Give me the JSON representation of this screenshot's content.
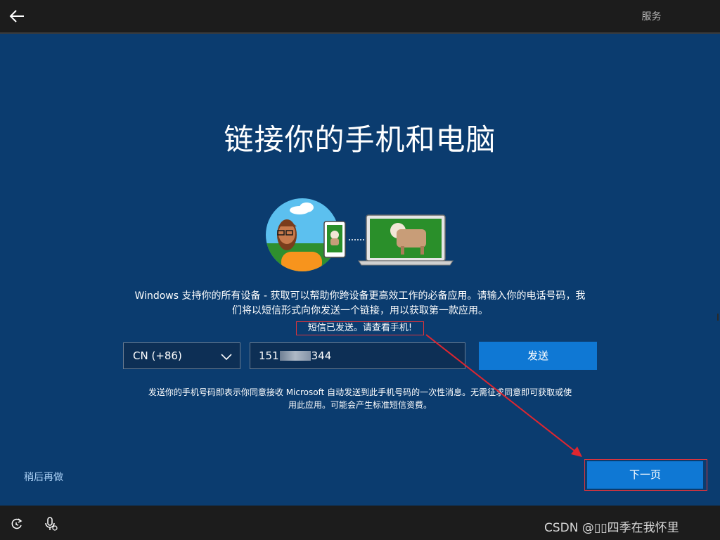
{
  "header": {
    "back_icon": "back-arrow-icon",
    "tab_label": "服务"
  },
  "main": {
    "title": "链接你的手机和电脑",
    "description": "Windows 支持你的所有设备 - 获取可以帮助你跨设备更高效工作的必备应用。请输入你的电话号码，我们将以短信形式向你发送一个链接，用以获取第一款应用。",
    "status_message": "短信已发送。请查看手机!",
    "country_select": {
      "value": "CN (+86)",
      "icon": "chevron-down-icon"
    },
    "phone_input": {
      "prefix": "151",
      "suffix": "344"
    },
    "send_label": "发送",
    "legal": "发送你的手机号码即表示你同意接收 Microsoft 自动发送到此手机号码的一次性消息。无需征求同意即可获取或使用此应用。可能会产生标准短信资费。"
  },
  "footer": {
    "later_label": "稍后再做",
    "next_label": "下一页"
  },
  "taskbar": {
    "ease_icon": "ease-of-access-icon",
    "mic_icon": "microphone-icon",
    "watermark": "CSDN @▯▯四季在我怀里"
  },
  "colors": {
    "background": "#0b3c6f",
    "bar": "#1c1c1c",
    "accent": "#0f78d4",
    "highlight_border": "#d9343d"
  }
}
